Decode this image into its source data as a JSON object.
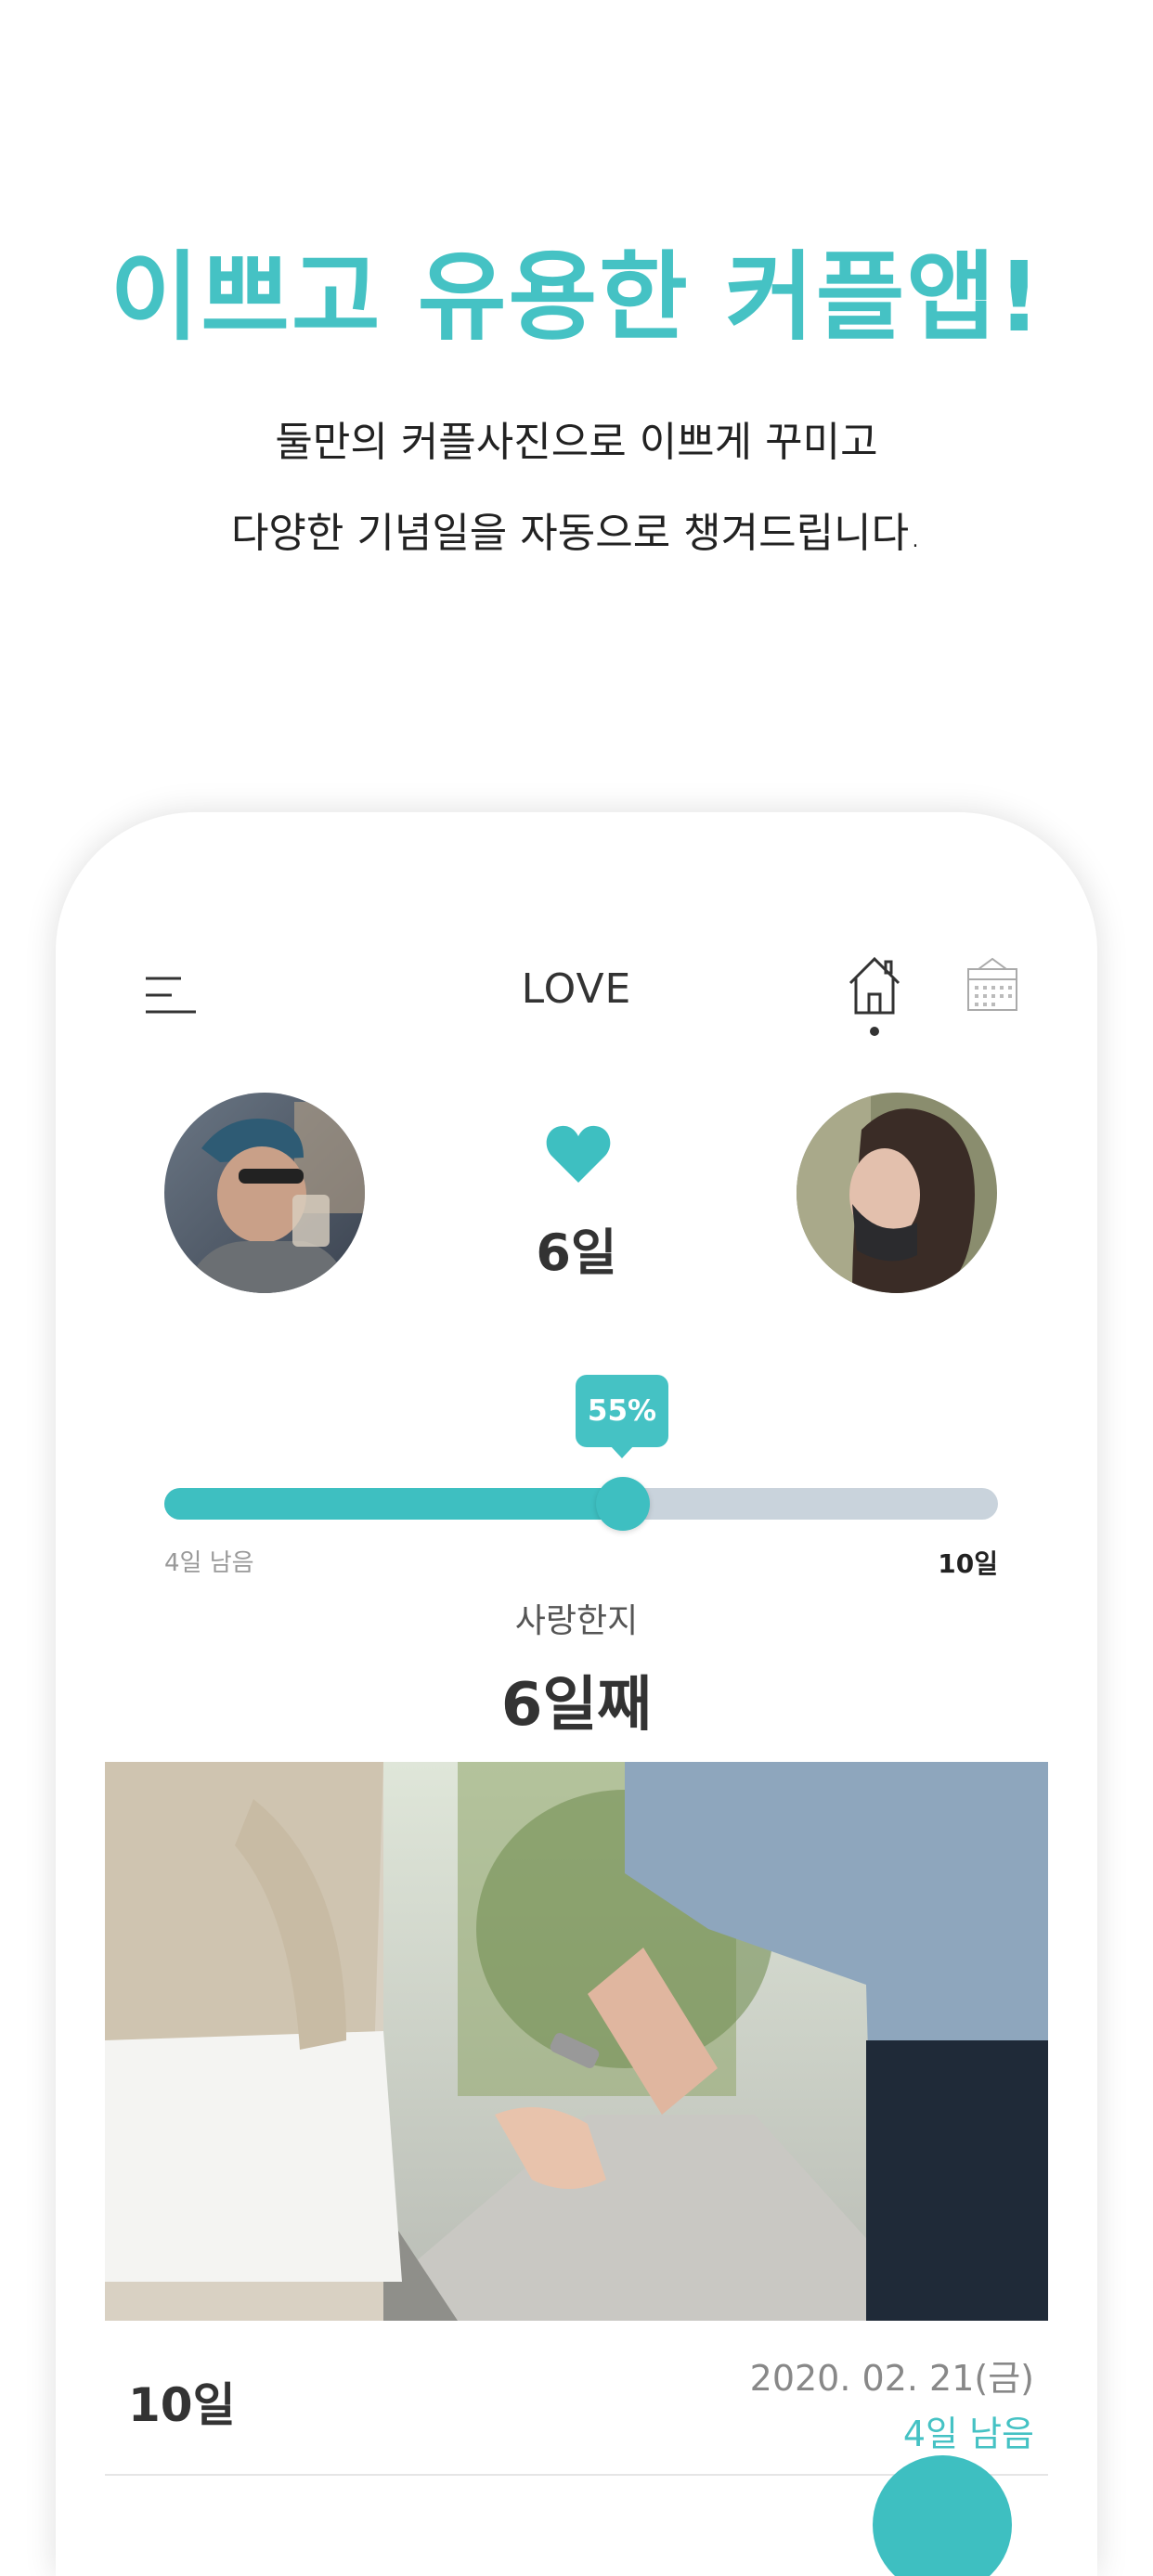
{
  "promo": {
    "headline": "이쁘고 유용한 커플앱!",
    "subline1": "둘만의 커플사진으로 이쁘게 꾸미고",
    "subline2": "다양한 기념일을 자동으로 챙겨드립니다."
  },
  "header": {
    "title": "LOVE",
    "icons": [
      "menu-icon",
      "home-icon",
      "calendar-icon"
    ]
  },
  "couple": {
    "days_together": "6일",
    "icon": "heart-icon"
  },
  "progress": {
    "percent_label": "55%",
    "fraction": 0.55,
    "remaining_label": "4일 남음",
    "target_label": "10일"
  },
  "counter": {
    "label": "사랑한지",
    "value": "6일째"
  },
  "anniversary_row": {
    "day": "10일",
    "date": "2020. 02. 21(금)",
    "remaining": "4일 남음"
  },
  "colors": {
    "accent": "#45c2c4",
    "track": "#c9d3dc",
    "text": "#333333"
  }
}
